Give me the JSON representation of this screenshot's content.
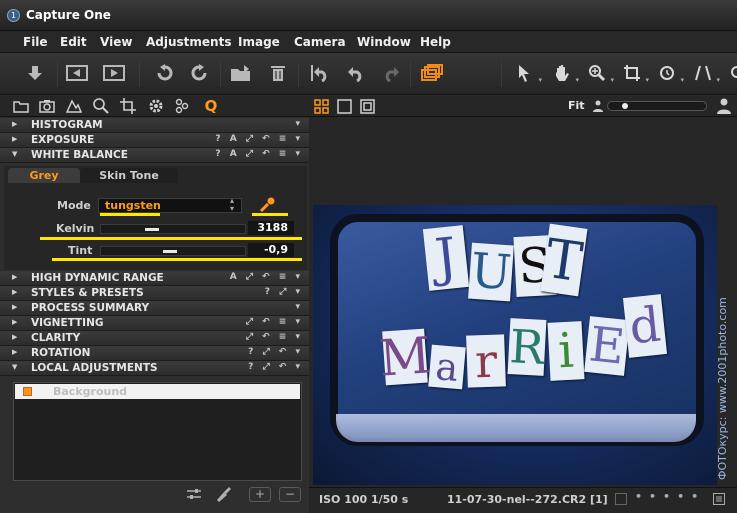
{
  "app": {
    "title": "Capture One"
  },
  "menu": [
    "File",
    "Edit",
    "View",
    "Adjustments",
    "Image",
    "Camera",
    "Window",
    "Help"
  ],
  "sections_top": [
    {
      "label": "HISTOGRAM",
      "expanded": false,
      "actions": "▾"
    },
    {
      "label": "EXPOSURE",
      "expanded": false,
      "actions": "? A ⤢ ↶ ≡ ▾"
    },
    {
      "label": "WHITE BALANCE",
      "expanded": true,
      "actions": "? A ⤢ ↶ ≡ ▾"
    }
  ],
  "white_balance": {
    "tabs": [
      "Grey",
      "Skin Tone"
    ],
    "mode_label": "Mode",
    "mode_value": "tungsten",
    "kelvin_label": "Kelvin",
    "kelvin_value": "3188",
    "tint_label": "Tint",
    "tint_value": "-0,9"
  },
  "sections_bottom": [
    {
      "label": "HIGH DYNAMIC RANGE",
      "actions": "A ⤢ ↶ ≡ ▾"
    },
    {
      "label": "STYLES & PRESETS",
      "actions": "? ⤢ ▾"
    },
    {
      "label": "PROCESS SUMMARY",
      "actions": "▾"
    },
    {
      "label": "VIGNETTING",
      "actions": "⤢ ↶ ≡ ▾"
    },
    {
      "label": "CLARITY",
      "actions": "⤢ ↶ ≡ ▾"
    },
    {
      "label": "ROTATION",
      "actions": "? ⤢ ↶ ▾"
    },
    {
      "label": "LOCAL ADJUSTMENTS",
      "actions": "? ⤢ ↶ ▾"
    }
  ],
  "local_adjustments": {
    "layer": "Background"
  },
  "viewer": {
    "fit_label": "Fit"
  },
  "photo": {
    "letters_top": [
      "J",
      "U",
      "S",
      "T"
    ],
    "letters_bottom": [
      "M",
      "a",
      "r",
      "R",
      "i",
      "E",
      "d"
    ]
  },
  "status": {
    "exposure": "ISO 100  1/50 s",
    "filename": "11-07-30-nel--272.CR2 [1]"
  },
  "watermark": "ФОТОкурс: www.2001photo.com",
  "colors": {
    "accent": "#ff9a1a",
    "highlight": "#ffe800"
  }
}
